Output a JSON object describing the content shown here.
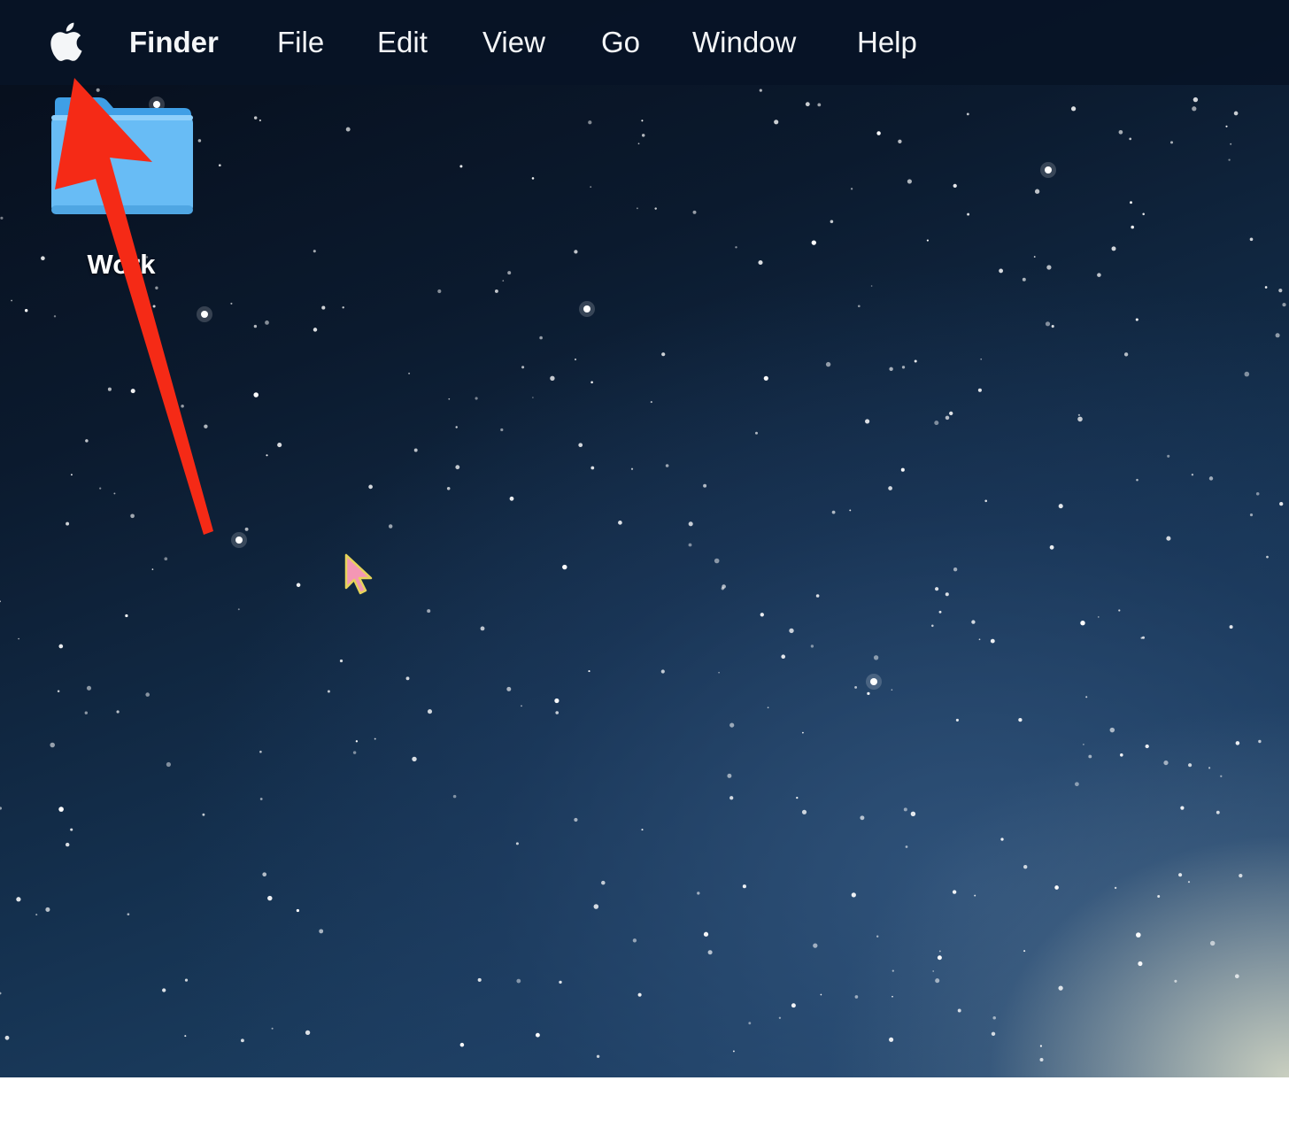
{
  "menubar": {
    "apple_icon": "apple-logo-icon",
    "app_name": "Finder",
    "items": [
      "File",
      "Edit",
      "View",
      "Go",
      "Window",
      "Help"
    ]
  },
  "desktop": {
    "folder_label": "Work",
    "folder_icon": "folder-icon",
    "folder_color": "#5fb6f3"
  },
  "annotation": {
    "color": "#f52a16"
  }
}
